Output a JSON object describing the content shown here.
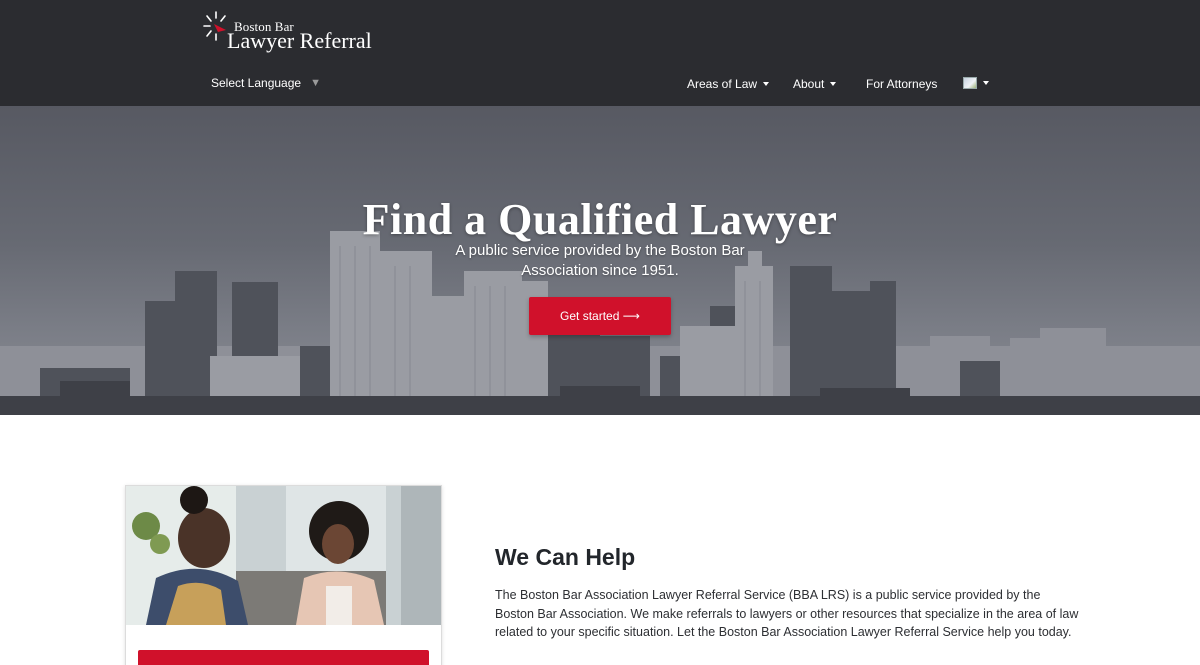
{
  "header": {
    "logo": {
      "line1": "Boston Bar",
      "line2": "Lawyer Referral"
    },
    "language": {
      "label": "Select Language",
      "caret": "▼"
    },
    "nav": [
      {
        "label": "Areas of Law",
        "has_dropdown": true
      },
      {
        "label": "About",
        "has_dropdown": true
      },
      {
        "label": "For Attorneys",
        "has_dropdown": false
      }
    ],
    "flag_icon": "language-flag-icon"
  },
  "hero": {
    "title": "Find a Qualified Lawyer",
    "subtitle": "A public service provided by the Boston Bar Association since 1951.",
    "cta_label": "Get started ⟶",
    "cta_color": "#d0112b"
  },
  "help": {
    "title": "We Can Help",
    "body": "The Boston Bar Association Lawyer Referral Service (BBA LRS) is a public service provided by the Boston Bar Association. We make referrals to lawyers or other resources that specialize in the area of law related to your specific situation. Let the Boston Bar Association Lawyer Referral Service help you today."
  },
  "colors": {
    "header_bg": "#2b2c30",
    "accent_red": "#d0112b",
    "heading": "#22262b"
  }
}
